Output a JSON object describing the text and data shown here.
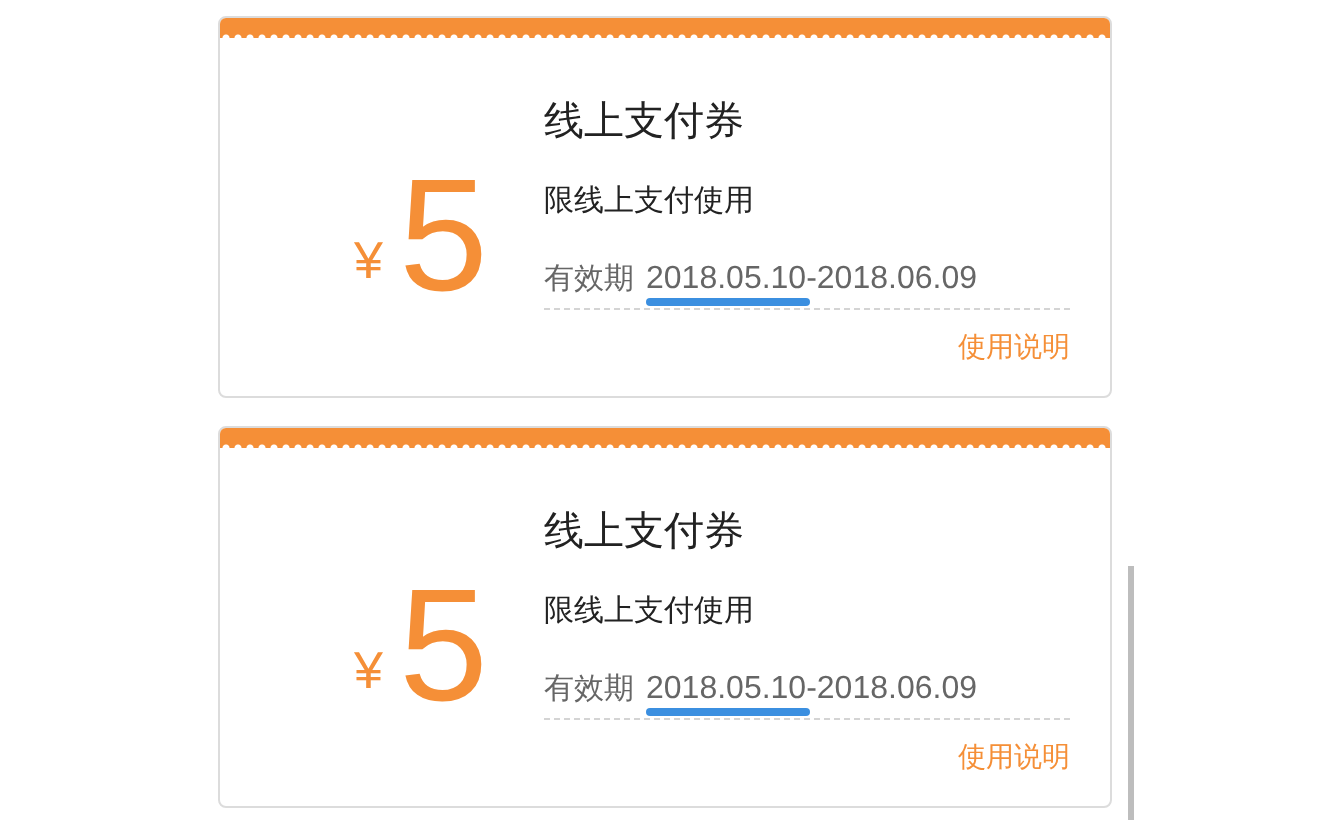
{
  "coupons": [
    {
      "currency": "¥",
      "amount": "5",
      "title": "线上支付券",
      "restriction": "限线上支付使用",
      "validity_label": "有效期",
      "validity": "2018.05.10-2018.06.09",
      "validity_underlined": true,
      "link": "使用说明"
    },
    {
      "currency": "¥",
      "amount": "5",
      "title": "线上支付券",
      "restriction": "限线上支付使用",
      "validity_label": "有效期",
      "validity": "2018.05.10-2018.06.09",
      "validity_underlined": true,
      "link": "使用说明"
    }
  ]
}
